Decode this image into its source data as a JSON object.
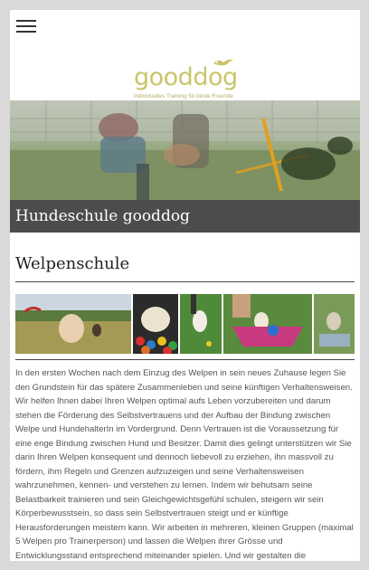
{
  "header": {
    "menu_icon": "hamburger-menu-icon",
    "logo": {
      "name": "gooddog",
      "tagline": "individuelles Training für beste Freunde",
      "accent_color": "#c9c56a"
    }
  },
  "hero": {
    "title": "Hundeschule gooddog",
    "band_color": "#4c4c4c"
  },
  "main": {
    "heading": "Welpenschule",
    "gallery_items": [
      "puppy-on-grass",
      "puppy-in-ball-pit",
      "puppy-on-lawn",
      "puppy-in-wheelbarrow",
      "puppy-on-platform"
    ],
    "body": "In den ersten Wochen nach dem Einzug des Welpen in sein neues Zuhause legen Sie den Grundstein für das spätere Zusammenleben und seine künftigen Verhaltensweisen. Wir helfen Ihnen dabei Ihren Welpen optimal aufs Leben vorzubereiten und darum stehen die Förderung des Selbstvertrauens und der Aufbau der Bindung zwischen Welpe und HundehalterIn im Vordergrund. Denn Vertrauen ist die Voraussetzung für eine enge Bindung zwischen Hund und Besitzer. Damit dies gelingt unterstützen wir Sie darin Ihren Welpen konsequent und dennoch liebevoll zu erziehen, ihn massvoll zu fördern, ihm Regeln und Grenzen aufzuzeigen und seine Verhaltensweisen wahrzunehmen, kennen- und verstehen zu lernen. Indem wir behutsam seine Belastbarkeit trainieren und sein Gleichgewichtsgefühl schulen, steigern wir sein Körperbewusstsein, so dass sein Selbstvertrauen steigt und er künftige Herausforderungen meistern kann. Wir arbeiten in mehreren, kleinen Gruppen (maximal 5 Welpen pro Trainerperson) und lassen die Welpen ihrer Grösse und Entwicklungsstand entsprechend miteinander spielen. Und wir gestalten die"
  }
}
